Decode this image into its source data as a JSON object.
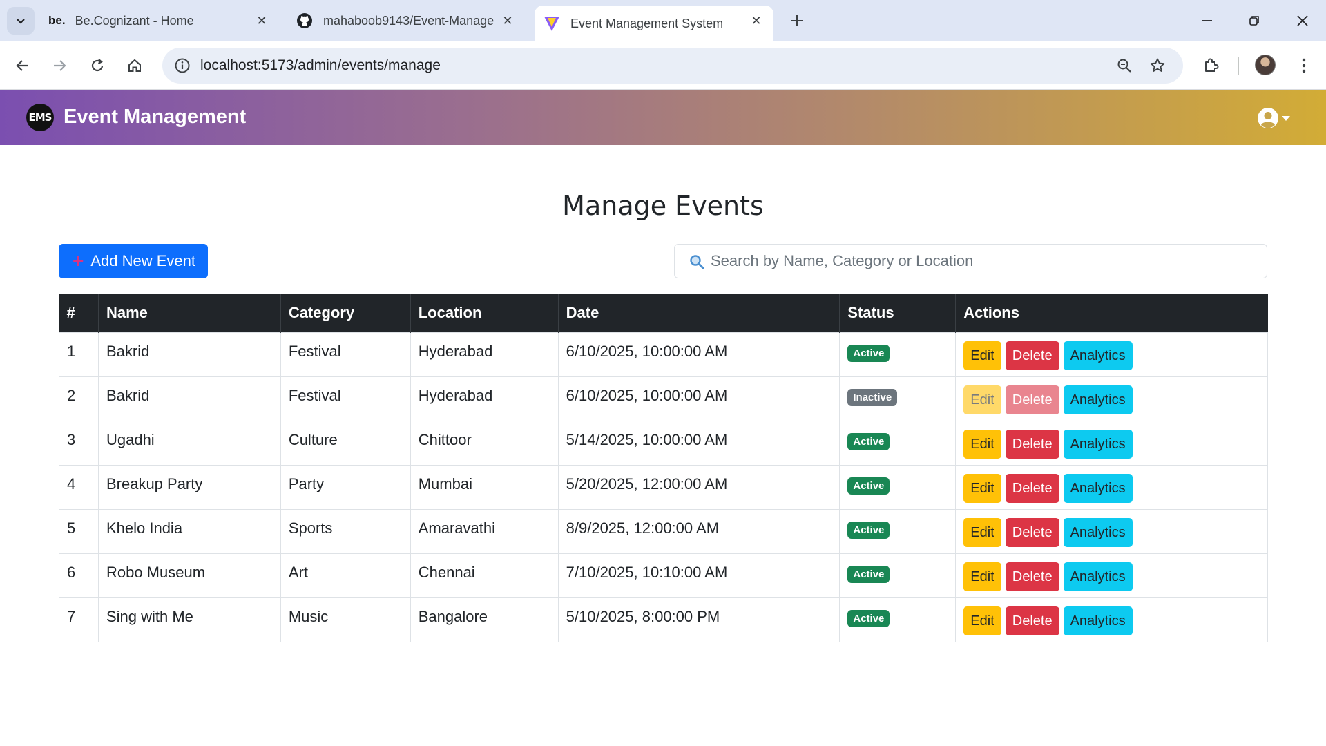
{
  "browser": {
    "tabs": [
      {
        "favicon": "be.",
        "title": "Be.Cognizant - Home"
      },
      {
        "title": "mahaboob9143/Event-Manage"
      },
      {
        "title": "Event Management System"
      }
    ],
    "url": "localhost:5173/admin/events/manage"
  },
  "app": {
    "logo_text": "EMS",
    "brand": "Event Management"
  },
  "page": {
    "title": "Manage Events",
    "add_button": "Add New Event",
    "search_placeholder": "Search by Name, Category or Location"
  },
  "table": {
    "headers": [
      "#",
      "Name",
      "Category",
      "Location",
      "Date",
      "Status",
      "Actions"
    ],
    "action_labels": {
      "edit": "Edit",
      "delete": "Delete",
      "analytics": "Analytics"
    },
    "rows": [
      {
        "num": "1",
        "name": "Bakrid",
        "category": "Festival",
        "location": "Hyderabad",
        "date": "6/10/2025, 10:00:00 AM",
        "status": "Active"
      },
      {
        "num": "2",
        "name": "Bakrid",
        "category": "Festival",
        "location": "Hyderabad",
        "date": "6/10/2025, 10:00:00 AM",
        "status": "Inactive"
      },
      {
        "num": "3",
        "name": "Ugadhi",
        "category": "Culture",
        "location": "Chittoor",
        "date": "5/14/2025, 10:00:00 AM",
        "status": "Active"
      },
      {
        "num": "4",
        "name": "Breakup Party",
        "category": "Party",
        "location": "Mumbai",
        "date": "5/20/2025, 12:00:00 AM",
        "status": "Active"
      },
      {
        "num": "5",
        "name": "Khelo India",
        "category": "Sports",
        "location": "Amaravathi",
        "date": "8/9/2025, 12:00:00 AM",
        "status": "Active"
      },
      {
        "num": "6",
        "name": "Robo Museum",
        "category": "Art",
        "location": "Chennai",
        "date": "7/10/2025, 10:10:00 AM",
        "status": "Active"
      },
      {
        "num": "7",
        "name": "Sing with Me",
        "category": "Music",
        "location": "Bangalore",
        "date": "5/10/2025, 8:00:00 PM",
        "status": "Active"
      }
    ]
  },
  "colors": {
    "primary": "#0d6efd",
    "warning": "#ffc107",
    "danger": "#dc3545",
    "info": "#0dcaf0",
    "success": "#198754",
    "secondary": "#6c757d",
    "table_header": "#212529"
  }
}
